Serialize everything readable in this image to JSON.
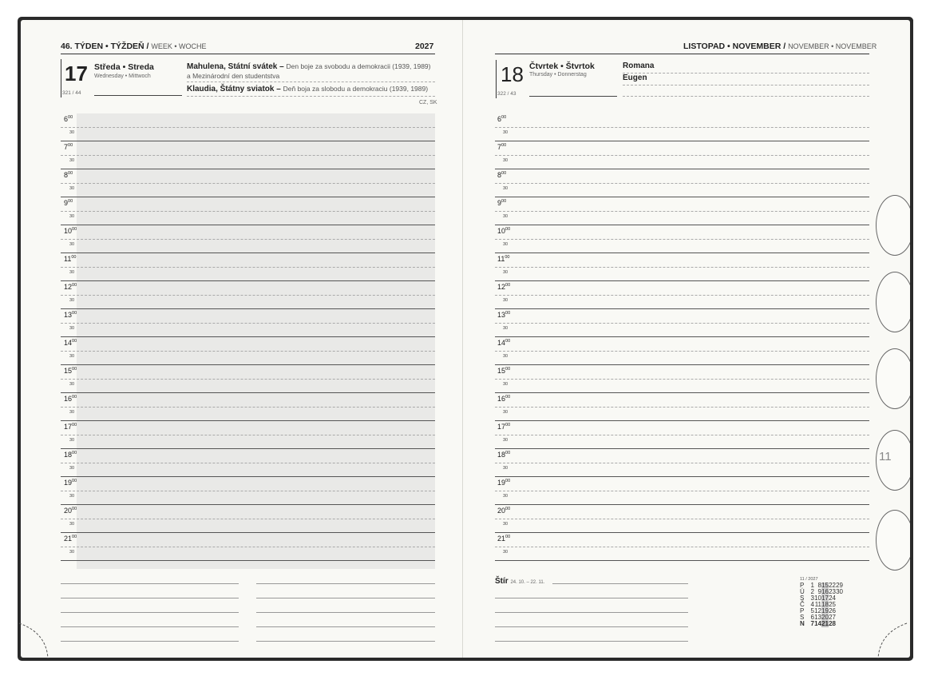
{
  "left": {
    "week_header_bold": "46. TÝDEN • TÝŽDEŇ /",
    "week_header_light": "WEEK • WOCHE",
    "year": "2027",
    "day_number": "17",
    "day_name": "Středa • Streda",
    "day_name_foreign": "Wednesday • Mittwoch",
    "day_ordinal": "321 / 44",
    "holiday1_name": "Mahulena, Státní svátek –",
    "holiday1_desc": "Den boje za svobodu a demokracii (1939, 1989)",
    "holiday1_line2": "a Mezinárodní den studentstva",
    "holiday2_name": "Klaudia, Štátny sviatok –",
    "holiday2_desc": "Deň boja za slobodu a demokraciu (1939, 1989)",
    "country_codes": "CZ, SK"
  },
  "right": {
    "month_header_bold": "LISTOPAD • NOVEMBER /",
    "month_header_light": "NOVEMBER • NOVEMBER",
    "day_number": "18",
    "day_name": "Čtvrtek • Štvrtok",
    "day_name_foreign": "Thursday • Donnerstag",
    "day_ordinal": "322 / 43",
    "name1": "Romana",
    "name2": "Eugen",
    "zodiac_name": "Štír",
    "zodiac_dates": "24. 10. – 22. 11.",
    "tab_number": "11"
  },
  "hours": [
    "6",
    "7",
    "8",
    "9",
    "10",
    "11",
    "12",
    "13",
    "14",
    "15",
    "16",
    "17",
    "18",
    "19",
    "20",
    "21"
  ],
  "hour_suffix": "00",
  "half_label": "30",
  "mini_calendar": {
    "title": "11 / 2027",
    "rows": [
      {
        "day": "P",
        "dates": [
          "1",
          "8",
          "15",
          "22",
          "29"
        ]
      },
      {
        "day": "Ú",
        "dates": [
          "2",
          "9",
          "16",
          "23",
          "30"
        ]
      },
      {
        "day": "S",
        "dates": [
          "3",
          "10",
          "17",
          "24",
          ""
        ]
      },
      {
        "day": "Č",
        "dates": [
          "4",
          "11",
          "18",
          "25",
          ""
        ]
      },
      {
        "day": "P",
        "dates": [
          "5",
          "12",
          "19",
          "26",
          ""
        ]
      },
      {
        "day": "S",
        "dates": [
          "6",
          "13",
          "20",
          "27",
          ""
        ]
      },
      {
        "day": "N",
        "dates": [
          "7",
          "14",
          "21",
          "28",
          ""
        ]
      }
    ],
    "highlight_col": 2
  }
}
